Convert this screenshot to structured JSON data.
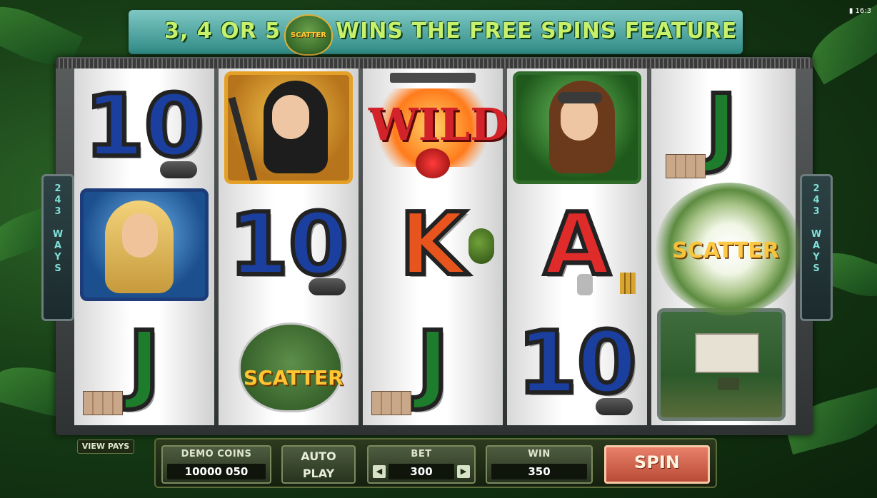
{
  "banner": {
    "prefix": "3, 4 OR 5",
    "badge": "SCATTER",
    "suffix": "WINS THE FREE SPINS FEATURE"
  },
  "status_bar": {
    "time": "16:3"
  },
  "side_label": "243 WAYS",
  "reels": [
    {
      "cells": [
        {
          "symbol": "10",
          "label": "10"
        },
        {
          "symbol": "blonde-soldier-portrait"
        },
        {
          "symbol": "J",
          "label": "J"
        }
      ]
    },
    {
      "cells": [
        {
          "symbol": "black-haired-soldier-portrait"
        },
        {
          "symbol": "10",
          "label": "10"
        },
        {
          "symbol": "scatter",
          "label": "SCATTER"
        }
      ]
    },
    {
      "cells": [
        {
          "symbol": "wild",
          "label": "WILD"
        },
        {
          "symbol": "K",
          "label": "K"
        },
        {
          "symbol": "J",
          "label": "J"
        }
      ]
    },
    {
      "cells": [
        {
          "symbol": "goggles-soldier-portrait"
        },
        {
          "symbol": "A",
          "label": "A"
        },
        {
          "symbol": "10",
          "label": "10"
        }
      ]
    },
    {
      "cells": [
        {
          "symbol": "J",
          "label": "J"
        },
        {
          "symbol": "scatter-exploding",
          "label": "SCATTER"
        },
        {
          "symbol": "jungle-mansion"
        }
      ]
    }
  ],
  "controls": {
    "view_pays": "VIEW PAYS",
    "demo_coins_label": "DEMO COINS",
    "demo_coins_value": "10000 050",
    "auto_play_line1": "AUTO",
    "auto_play_line2": "PLAY",
    "bet_label": "BET",
    "bet_value": "300",
    "win_label": "WIN",
    "win_value": "350",
    "spin_label": "SPIN"
  },
  "colors": {
    "ten": "#1b3f9e",
    "jack": "#1e7d2c",
    "king": "#e8541d",
    "ace": "#e02b2b",
    "banner_text": "#c7f06b",
    "spin": "#d7664e"
  }
}
